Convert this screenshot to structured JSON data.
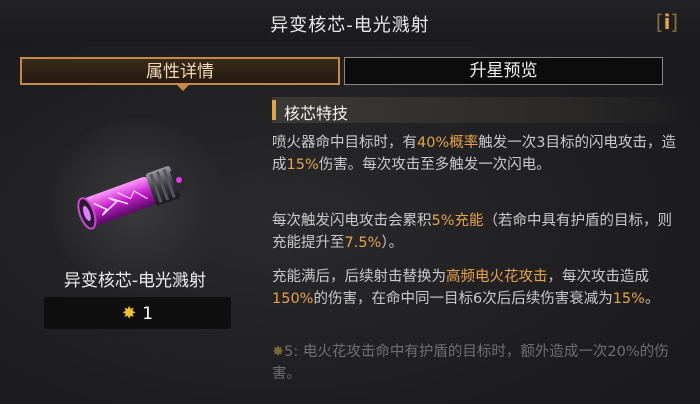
{
  "header": {
    "title": "异变核芯-电光溅射",
    "info_glyph": "i"
  },
  "tabs": [
    {
      "label": "属性详情",
      "active": true
    },
    {
      "label": "升星预览",
      "active": false
    }
  ],
  "item": {
    "name": "异变核芯-电光溅射",
    "star_count": "1",
    "icon": "plasma-core-canister-icon"
  },
  "section": {
    "title": "核芯特技"
  },
  "desc": {
    "p1": {
      "a": "喷火器命中目标时，有",
      "b": "40%概率",
      "c": "触发一次3目标的闪电攻击，造成",
      "d": "15%",
      "e": "伤害。每次攻击至多触发一次闪电。"
    },
    "p2": {
      "a": "每次触发闪电攻击会累积",
      "b": "5%充能",
      "c": "（若命中具有护盾的目标，则充能提升至",
      "d": "7.5%",
      "e": "）。"
    },
    "p3": {
      "a": "充能满后，后续射击替换为",
      "b": "高频电火花攻击",
      "c": "，每次攻击造成",
      "d": "150%",
      "e": "的伤害，在命中同一目标6次后后续伤害衰减为",
      "f": "15%",
      "g": "。"
    },
    "p4": {
      "a": "5: 电火花攻击命中有护盾的目标时，额外造成一次20%的伤害。"
    }
  },
  "colors": {
    "accent": "#e2a24b",
    "highlight": "#e8a24c",
    "star": "#f2c02e",
    "item_glow": "#d63ad6"
  }
}
